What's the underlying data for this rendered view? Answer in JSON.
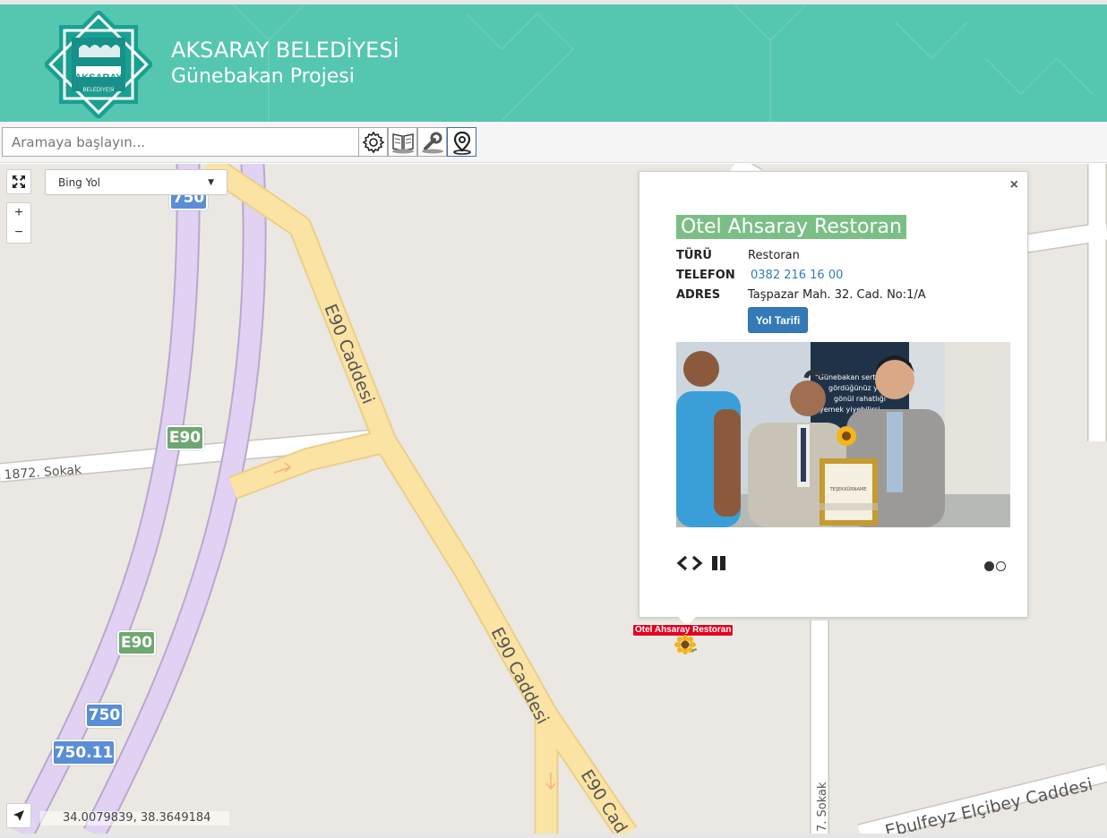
{
  "header": {
    "title": "AKSARAY BELEDİYESİ",
    "subtitle": "Günebakan Projesi",
    "logo_text": "AKSARAY",
    "logo_subtext": "BELEDİYESİ",
    "background_color": "#55c6b0"
  },
  "toolbar": {
    "search_placeholder": "Aramaya başlayın...",
    "buttons": [
      {
        "name": "settings",
        "icon": "gear-icon"
      },
      {
        "name": "layers",
        "icon": "book-map-icon"
      },
      {
        "name": "tools",
        "icon": "wrench-icon"
      },
      {
        "name": "location",
        "icon": "map-pin-icon",
        "active": true
      }
    ]
  },
  "map": {
    "layer_selected": "Bing Yol",
    "zoom_in": "+",
    "zoom_out": "−",
    "coordinates": "34.0079839, 38.3649184",
    "road_labels": {
      "e90_north": "E90 Caddesi",
      "e90_south": "E90 Caddesi",
      "e90_bottom": "E90 Cad",
      "sokak_1872": "1872. Sokak",
      "sokak_7": "7. Sokak",
      "elcibey": "Ebulfeyz Elçibey Caddesi"
    },
    "shields": {
      "s750_top": "750",
      "e90_a": "E90",
      "e90_b": "E90",
      "s750_b": "750",
      "s750_11": "750.11"
    }
  },
  "popup": {
    "close": "×",
    "title": "Otel Ahsaray Restoran",
    "rows": [
      {
        "key": "TÜRÜ",
        "value": "Restoran"
      },
      {
        "key": "TELEFON",
        "value": "0382 216 16 00"
      },
      {
        "key": "ADRES",
        "value": "Taşpazar Mah. 32. Cad. No:1/A"
      }
    ],
    "directions_button": "Yol Tarifi",
    "slider": {
      "current": 1,
      "total": 2
    },
    "banner_lines": [
      "\"Günebakan sert",
      "gördüğünüz yer",
      "gönül rahatlığı",
      "yemek yiyebilirsi"
    ],
    "certificate_text": "TEŞEKKÜRNAME",
    "link_color": "#337ab7"
  },
  "marker": {
    "label": "Otel Ahsaray Restoran",
    "icon": "sunflower-icon"
  }
}
